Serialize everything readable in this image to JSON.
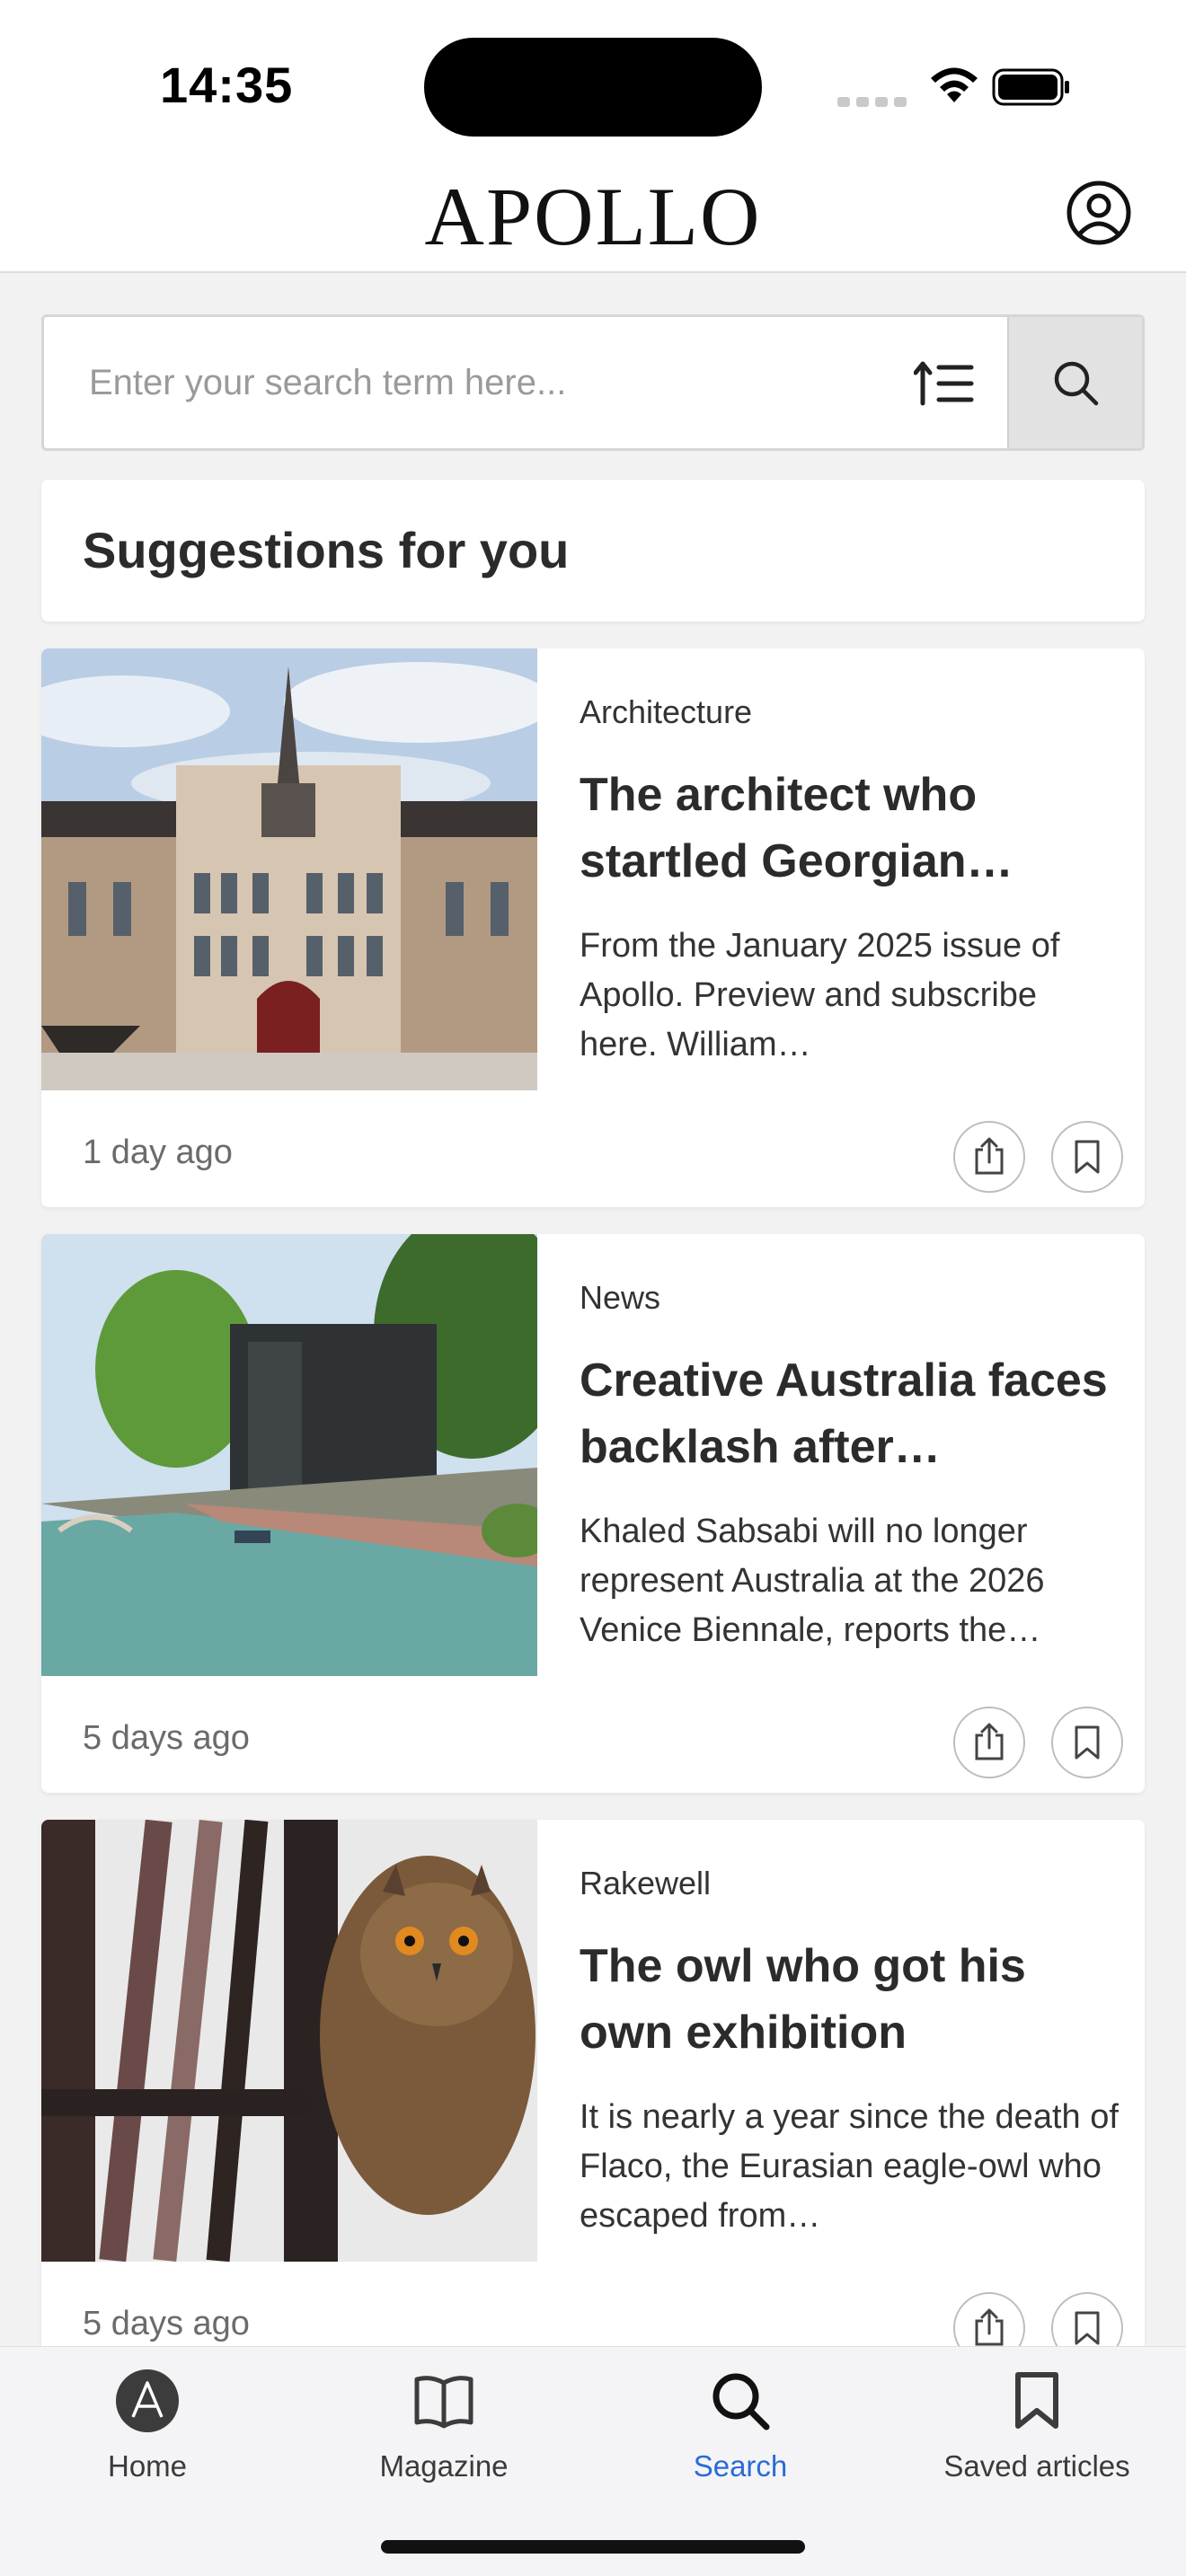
{
  "status_bar": {
    "time": "14:35"
  },
  "header": {
    "logo": "APOLLO",
    "profile_icon": "account-circle-icon"
  },
  "search": {
    "placeholder": "Enter your search term here...",
    "value": "",
    "sort_icon": "sort-ascending-icon",
    "search_icon": "search-icon"
  },
  "suggestions": {
    "title": "Suggestions for you"
  },
  "articles": [
    {
      "category": "Architecture",
      "title": "The architect who startled Georgian…",
      "excerpt": "From the January 2025 issue of Apollo. Preview and subscribe here. William…",
      "time": "1 day ago"
    },
    {
      "category": "News",
      "title": "Creative Australia faces backlash after…",
      "excerpt": "Khaled Sabsabi will no longer represent Australia at the 2026 Venice Biennale, reports the…",
      "time": "5 days ago"
    },
    {
      "category": "Rakewell",
      "title": "The owl who got his own exhibition",
      "excerpt": "It is nearly a year since the death of Flaco, the Eurasian eagle-owl who escaped from…",
      "time": "5 days ago"
    }
  ],
  "tab_bar": {
    "items": [
      {
        "label": "Home",
        "icon": "apollo-home-icon",
        "active": false
      },
      {
        "label": "Magazine",
        "icon": "open-book-icon",
        "active": false
      },
      {
        "label": "Search",
        "icon": "search-icon",
        "active": true
      },
      {
        "label": "Saved articles",
        "icon": "bookmark-icon",
        "active": false
      }
    ]
  },
  "colors": {
    "accent": "#2a6ad8",
    "background": "#f2f2f2",
    "card": "#ffffff"
  }
}
